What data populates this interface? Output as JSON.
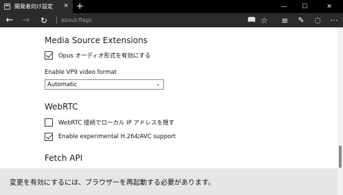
{
  "window": {
    "tab_title": "開発者向け設定",
    "tab_close": "✕",
    "new_tab": "+",
    "minimize": "—",
    "maximize": "☐",
    "close": "✕"
  },
  "toolbar": {
    "back": "←",
    "forward": "→",
    "refresh": "↻",
    "url": "about:flags",
    "reading_view": "📖",
    "favorite": "☆",
    "hub": "≡",
    "web_note": "✎",
    "share": "◌",
    "more": "⋯"
  },
  "content": {
    "sections": [
      {
        "heading": "Media Source Extensions",
        "checkbox_label": "Opus オーディオ形式を有効にする",
        "checkbox_checked": true,
        "field_label": "Enable VP9 video format",
        "select_value": "Automatic"
      },
      {
        "heading": "WebRTC",
        "checkbox1_label": "WebRTC 接続でローカル IP アドレスを隠す",
        "checkbox1_checked": false,
        "checkbox2_label": "Enable experimental H.264/AVC support",
        "checkbox2_checked": true
      },
      {
        "heading": "Fetch API"
      }
    ]
  },
  "notice": {
    "message": "変更を有効にするには、ブラウザーを再起動する必要があります。"
  }
}
